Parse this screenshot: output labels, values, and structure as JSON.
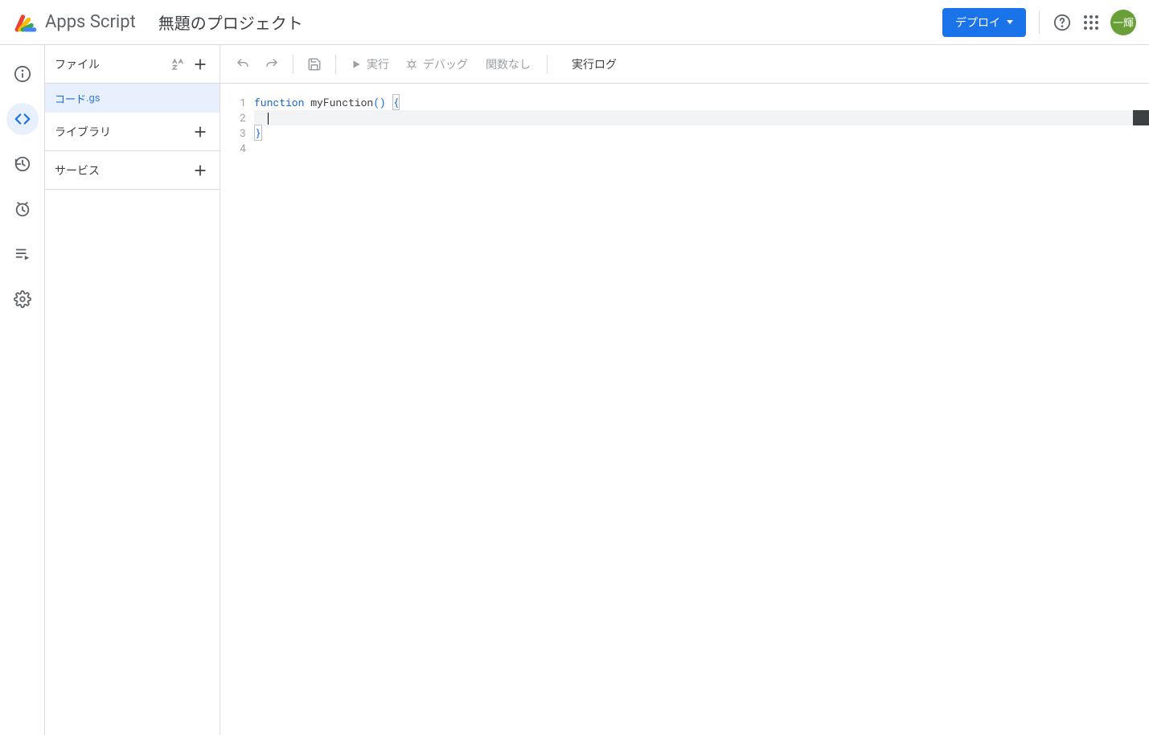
{
  "header": {
    "product_name": "Apps Script",
    "project_title": "無題のプロジェクト",
    "deploy_label": "デプロイ",
    "avatar_text": "一輝"
  },
  "navrail": {
    "items": [
      {
        "id": "overview",
        "name": "info-icon"
      },
      {
        "id": "editor",
        "name": "code-icon",
        "active": true
      },
      {
        "id": "history",
        "name": "history-icon"
      },
      {
        "id": "triggers",
        "name": "clock-icon"
      },
      {
        "id": "executions",
        "name": "playlist-icon"
      },
      {
        "id": "settings",
        "name": "gear-icon"
      }
    ]
  },
  "sidebar": {
    "files_label": "ファイル",
    "files": [
      {
        "name": "コード",
        "ext": ".gs",
        "selected": true
      }
    ],
    "library_label": "ライブラリ",
    "services_label": "サービス"
  },
  "toolbar": {
    "run_label": "実行",
    "debug_label": "デバッグ",
    "function_dropdown_label": "関数なし",
    "exec_log_label": "実行ログ"
  },
  "editor": {
    "lines": [
      {
        "num": "1"
      },
      {
        "num": "2"
      },
      {
        "num": "3"
      },
      {
        "num": "4"
      }
    ],
    "code_tokens": {
      "l1_kw": "function",
      "l1_name": " myFunction",
      "l1_paren": "()",
      "l1_space": " ",
      "l1_brace": "{",
      "l2_indent": "  ",
      "l3_brace": "}"
    }
  }
}
